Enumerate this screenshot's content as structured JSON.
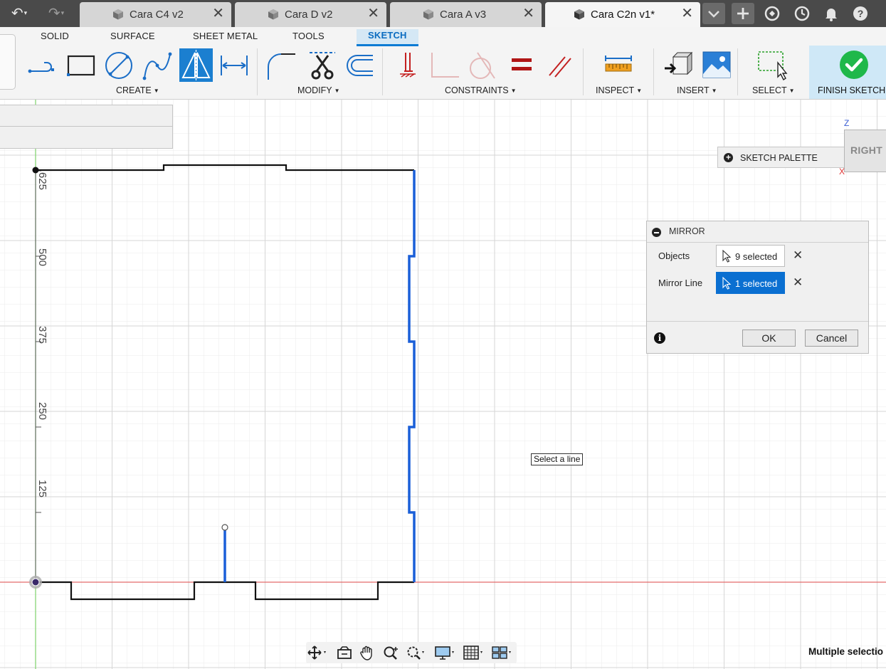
{
  "tabs": [
    {
      "label": "Cara C4 v2",
      "active": false
    },
    {
      "label": "Cara D v2",
      "active": false
    },
    {
      "label": "Cara A v3",
      "active": false
    },
    {
      "label": "Cara C2n v1*",
      "active": true
    }
  ],
  "tab_close_glyph": "✕",
  "ribbon_tabs": [
    "SOLID",
    "SURFACE",
    "SHEET METAL",
    "TOOLS",
    "SKETCH"
  ],
  "active_ribbon_tab": "SKETCH",
  "groups": {
    "create": "CREATE",
    "modify": "MODIFY",
    "constraints": "CONSTRAINTS",
    "inspect": "INSPECT",
    "insert": "INSERT",
    "select": "SELECT",
    "finish": "FINISH SKETCH"
  },
  "sketch_palette": {
    "title": "SKETCH PALETTE"
  },
  "viewcube": {
    "face": "RIGHT",
    "z": "Z",
    "x": "X"
  },
  "mirror_dialog": {
    "title": "MIRROR",
    "objects_label": "Objects",
    "objects_value": "9 selected",
    "mirror_line_label": "Mirror Line",
    "mirror_line_value": "1 selected",
    "clear_glyph": "✕",
    "info_glyph": "i",
    "ok": "OK",
    "cancel": "Cancel"
  },
  "tooltip": "Select a line",
  "dimension_labels": [
    "625",
    "500",
    "375",
    "250",
    "125"
  ],
  "status": "Multiple selectio",
  "colors": {
    "accent": "#0a6fd1",
    "selected_line": "#1a5fd8",
    "sketch_line": "#111111",
    "x_axis": "#e36a6a",
    "y_axis": "#7dd36a",
    "finish_green": "#1fb84a"
  }
}
